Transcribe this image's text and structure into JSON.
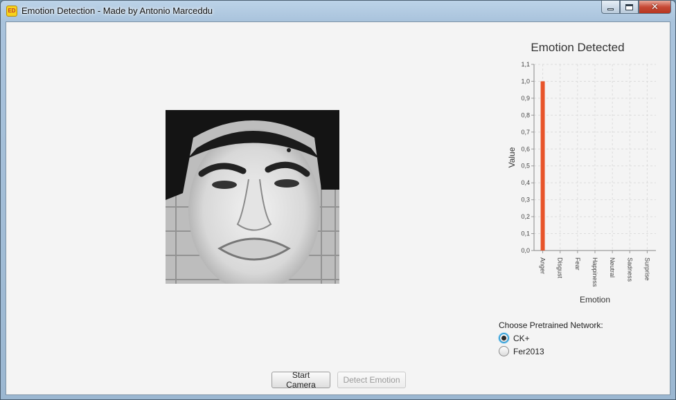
{
  "window": {
    "title": "Emotion Detection - Made by Antonio Marceddu",
    "icon": "app-logo-icon",
    "icon_text": "ED",
    "controls": [
      "minimize-icon",
      "maximize-icon",
      "close-icon"
    ]
  },
  "photo": {
    "description_icon": "face-photo"
  },
  "chart_data": {
    "type": "bar",
    "title": "Emotion Detected",
    "xlabel": "Emotion",
    "ylabel": "Value",
    "categories": [
      "Anger",
      "Disgust",
      "Fear",
      "Happiness",
      "Neutral",
      "Sadness",
      "Surprise"
    ],
    "values": [
      1.0,
      0,
      0,
      0,
      0,
      0,
      0
    ],
    "ylim": [
      0.0,
      1.1
    ],
    "yticks": [
      "0,0",
      "0,1",
      "0,2",
      "0,3",
      "0,4",
      "0,5",
      "0,6",
      "0,7",
      "0,8",
      "0,9",
      "1,0",
      "1,1"
    ],
    "grid": true,
    "bar_color": "#e8542a"
  },
  "network": {
    "label": "Choose Pretrained Network:",
    "options": [
      {
        "label": "CK+",
        "selected": true
      },
      {
        "label": "Fer2013",
        "selected": false
      }
    ]
  },
  "buttons": {
    "start_camera": "Start Camera",
    "detect_emotion": "Detect Emotion"
  },
  "colors": {
    "accent": "#3aa2d8",
    "bar": "#e8542a"
  }
}
